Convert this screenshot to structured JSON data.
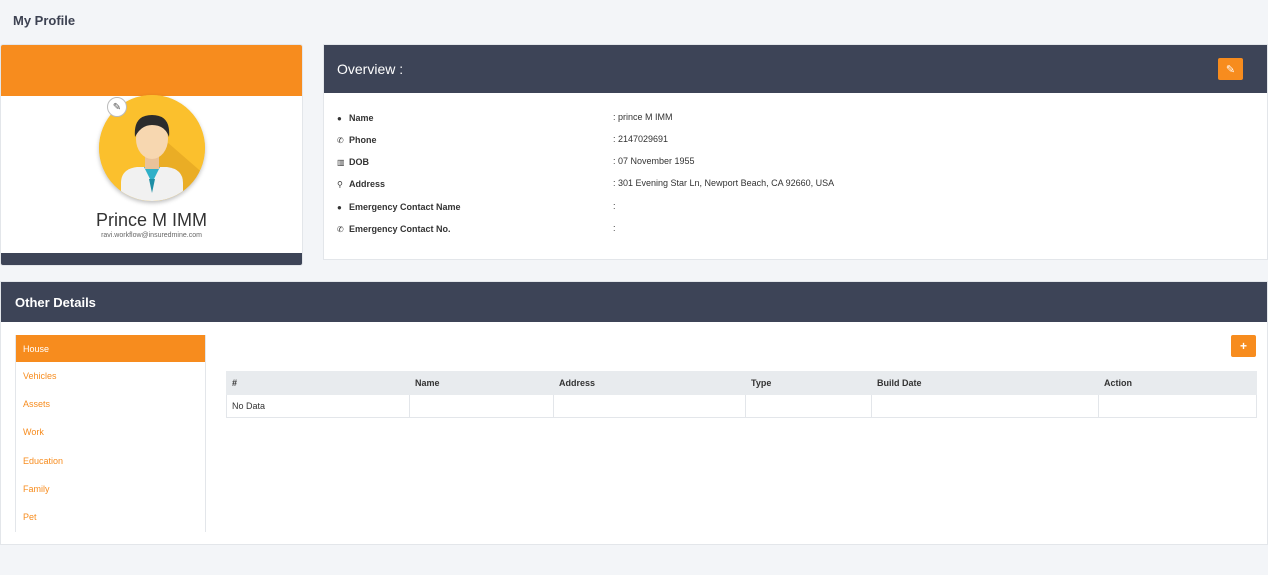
{
  "page": {
    "title": "My Profile"
  },
  "profile": {
    "name": "Prince M IMM",
    "email": "ravi.workflow@insuredmine.com"
  },
  "overview": {
    "title": "Overview :",
    "fields": [
      {
        "icon": "user-icon",
        "label": "Name",
        "value": ": prince M IMM"
      },
      {
        "icon": "phone-icon",
        "label": "Phone",
        "value": ": 2147029691"
      },
      {
        "icon": "cake-icon",
        "label": "DOB",
        "value": ": 07 November 1955"
      },
      {
        "icon": "map-marker-icon",
        "label": "Address",
        "value": ": 301 Evening Star Ln, Newport Beach, CA 92660, USA"
      },
      {
        "icon": "user-icon",
        "label": "Emergency Contact Name",
        "value": ":"
      },
      {
        "icon": "phone-icon",
        "label": "Emergency Contact No.",
        "value": ":"
      }
    ]
  },
  "other": {
    "title": "Other Details",
    "menu": [
      "House",
      "Vehicles",
      "Assets",
      "Work",
      "Education",
      "Family",
      "Pet"
    ],
    "active_menu": "House",
    "table": {
      "headers": [
        "#",
        "Name",
        "Address",
        "Type",
        "Build Date",
        "Action"
      ],
      "empty_text": "No Data"
    }
  },
  "colors": {
    "accent": "#f78c1e",
    "header": "#3d4457"
  }
}
